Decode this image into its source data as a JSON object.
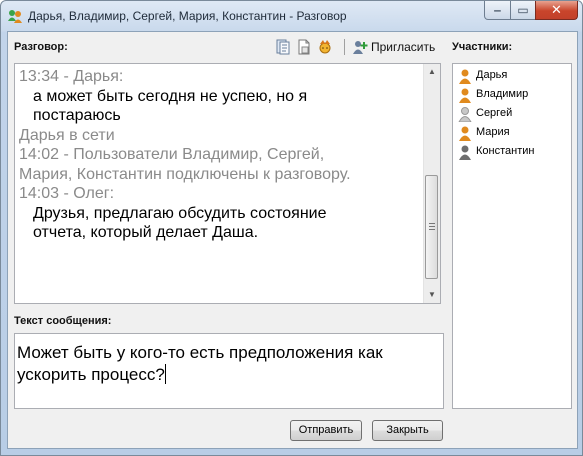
{
  "window": {
    "title": "Дарья, Владимир, Сергей, Мария, Константин - Разговор",
    "controls": {
      "minimize": "‒",
      "maximize": "▭",
      "close": "✕"
    }
  },
  "conversation": {
    "label": "Разговор:",
    "toolbar": {
      "invite_label": "Пригласить"
    },
    "lines": [
      {
        "type": "meta",
        "text": "13:34 - Дарья:"
      },
      {
        "type": "message",
        "text": "а может быть сегодня не успею, но я"
      },
      {
        "type": "message",
        "text": "постараюсь"
      },
      {
        "type": "meta",
        "text": "Дарья в сети"
      },
      {
        "type": "meta",
        "text": "14:02 - Пользователи Владимир, Сергей,"
      },
      {
        "type": "meta",
        "text": "Мария, Константин подключены к разговору."
      },
      {
        "type": "meta",
        "text": "14:03 - Олег:"
      },
      {
        "type": "message",
        "text": "Друзья, предлагаю обсудить состояние"
      },
      {
        "type": "message",
        "text": "отчета, который делает Даша."
      }
    ]
  },
  "participants": {
    "label": "Участники:",
    "items": [
      {
        "name": "Дарья",
        "color": "#e08a1e"
      },
      {
        "name": "Владимир",
        "color": "#e08a1e"
      },
      {
        "name": "Сергей",
        "color": "#c8c8c8"
      },
      {
        "name": "Мария",
        "color": "#e08a1e"
      },
      {
        "name": "Константин",
        "color": "#6e6e6e"
      }
    ]
  },
  "compose": {
    "label": "Текст сообщения:",
    "value_line1": "Может быть у кого-то есть предположения как",
    "value_line2": "ускорить процесс?"
  },
  "buttons": {
    "send": "Отправить",
    "close": "Закрыть"
  }
}
